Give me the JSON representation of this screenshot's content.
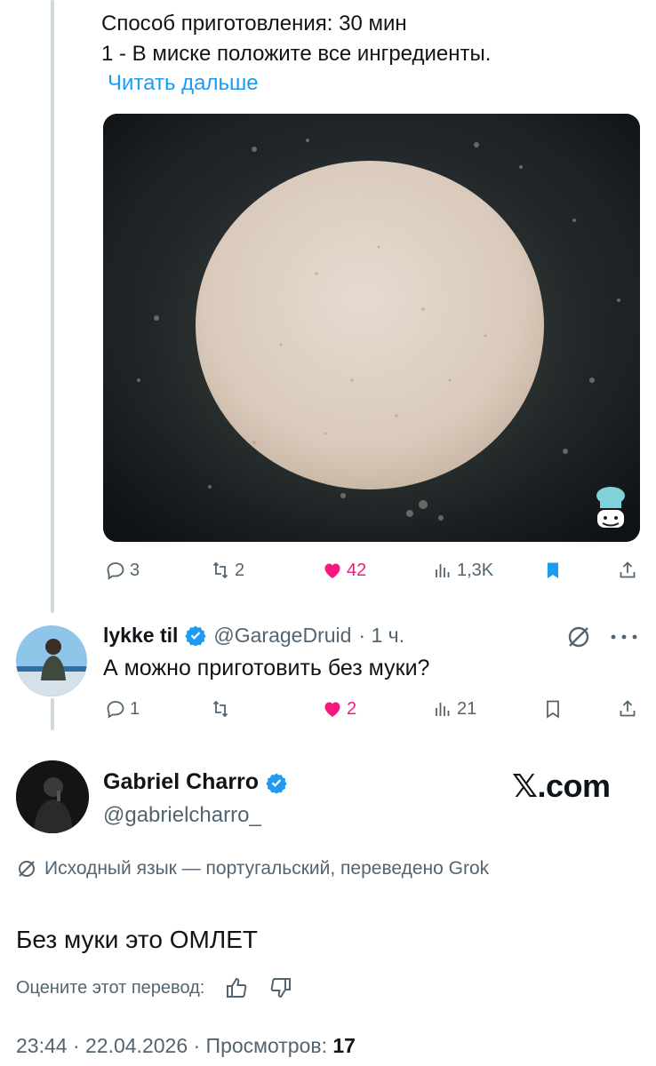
{
  "parent_post": {
    "line1": "Способ приготовления: 30 мин",
    "line2": "1 - В миске положите все ингредиенты.",
    "read_more": "Читать дальше",
    "media_icon": "chef-hat-icon",
    "replies": "3",
    "reposts": "2",
    "likes": "42",
    "views": "1,3K"
  },
  "reply": {
    "name": "lykke til",
    "handle": "@GarageDruid",
    "time": "· 1 ч.",
    "text": "А можно приготовить без муки?",
    "replies": "1",
    "reposts": "",
    "likes": "2",
    "views": "21"
  },
  "author": {
    "name": "Gabriel Charro",
    "handle": "@gabrielcharro_",
    "site": "𝕏.com"
  },
  "translation_note": "Исходный язык — португальский, переведено Grok",
  "main_text": "Без муки это ОМЛЕТ",
  "rate_label": "Оцените этот перевод:",
  "meta": {
    "time_date": "23:44 · 22.04.2026 · Просмотров:",
    "views": "17"
  },
  "colors": {
    "accent": "#1d9bf0",
    "like": "#f91880",
    "muted": "#536471"
  }
}
